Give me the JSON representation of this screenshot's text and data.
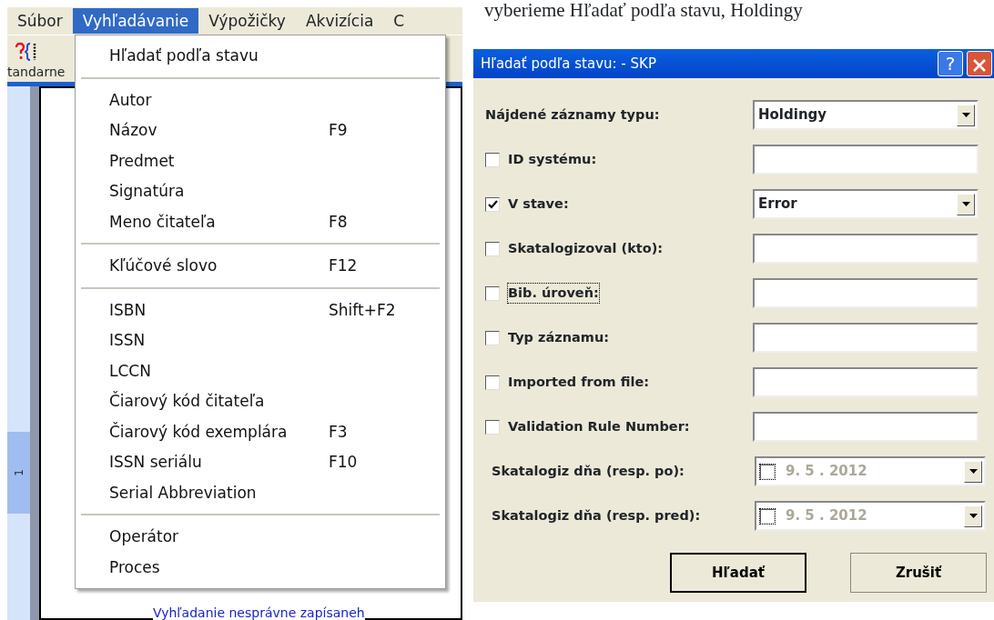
{
  "app": {
    "menu_bar": [
      {
        "label": "Súbor",
        "selected": false
      },
      {
        "label": "Vyhľadávanie",
        "selected": true
      },
      {
        "label": "Výpožičky",
        "selected": false
      },
      {
        "label": "Akvizícia",
        "selected": false
      },
      {
        "label": "C",
        "selected": false
      }
    ],
    "toolbar_tab": "tandarne",
    "ruler_label": "1",
    "document_text": "Vyhľadanie nesprávne zapísaneh",
    "menu_sections": [
      [
        {
          "label": "Hľadať podľa stavu"
        }
      ],
      [
        {
          "label": "Autor"
        },
        {
          "label": "Názov",
          "shortcut": "F9"
        },
        {
          "label": "Predmet"
        },
        {
          "label": "Signatúra"
        },
        {
          "label": "Meno čitateľa",
          "shortcut": "F8"
        }
      ],
      [
        {
          "label": "Kľúčové slovo",
          "shortcut": "F12"
        }
      ],
      [
        {
          "label": "ISBN",
          "shortcut": "Shift+F2"
        },
        {
          "label": "ISSN"
        },
        {
          "label": "LCCN"
        },
        {
          "label": "Čiarový kód čitateľa"
        },
        {
          "label": "Čiarový kód exemplára",
          "shortcut": "F3"
        },
        {
          "label": "ISSN seriálu",
          "shortcut": "F10"
        },
        {
          "label": "Serial Abbreviation"
        }
      ],
      [
        {
          "label": "Operátor"
        },
        {
          "label": "Proces"
        }
      ]
    ]
  },
  "caption": "vyberieme Hľadať podľa stavu, Holdingy",
  "dialog": {
    "title": "Hľadať podľa stavu: - SKP",
    "help_glyph": "?",
    "rows": [
      {
        "kind": "select",
        "label": "Nájdené záznamy typu:",
        "value": "Holdingy"
      },
      {
        "kind": "check_text",
        "label": "ID systému:",
        "checked": false
      },
      {
        "kind": "check_select",
        "label": "V stave:",
        "checked": true,
        "value": "Error"
      },
      {
        "kind": "check_text",
        "label": "Skatalogizoval (kto):",
        "checked": false
      },
      {
        "kind": "check_text",
        "label": "Bib. úroveň:",
        "checked": false,
        "focused": true
      },
      {
        "kind": "check_text",
        "label": "Typ záznamu:",
        "checked": false
      },
      {
        "kind": "check_text",
        "label": "Imported from file:",
        "checked": false
      },
      {
        "kind": "check_text",
        "label": "Validation Rule Number:",
        "checked": false
      },
      {
        "kind": "date",
        "label": "Skatalogiz dňa (resp. po):",
        "checked": false,
        "disabled": true,
        "value": "9.  5 . 2012"
      },
      {
        "kind": "date",
        "label": "Skatalogiz dňa (resp. pred):",
        "checked": false,
        "disabled": true,
        "value": "9.  5 . 2012"
      }
    ],
    "buttons": [
      {
        "label": "Hľadať",
        "default": true
      },
      {
        "label": "Zrušiť",
        "default": false
      }
    ]
  }
}
